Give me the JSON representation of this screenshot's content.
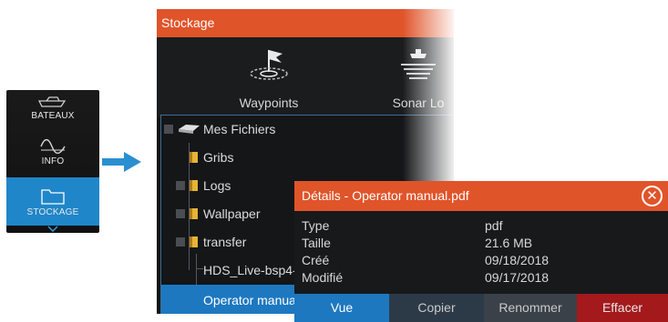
{
  "sidebar": {
    "items": [
      {
        "label": "BATEAUX",
        "icon": "boat-icon"
      },
      {
        "label": "INFO",
        "icon": "waveform-icon"
      },
      {
        "label": "STOCKAGE",
        "icon": "folder-icon",
        "selected": true
      }
    ]
  },
  "storage": {
    "title": "Stockage",
    "tiles": [
      {
        "label": "Waypoints",
        "icon": "waypoint-flag-icon"
      },
      {
        "label": "Sonar Lo",
        "icon": "sonar-log-icon"
      }
    ],
    "tree": [
      {
        "label": "Mes Fichiers",
        "icon": "drive-icon"
      },
      {
        "label": "Gribs",
        "icon": "folder-icon"
      },
      {
        "label": "Logs",
        "icon": "folder-icon"
      },
      {
        "label": "Wallpaper",
        "icon": "folder-icon"
      },
      {
        "label": "transfer",
        "icon": "folder-icon"
      },
      {
        "label": "HDS_Live-bsp4-"
      },
      {
        "label": "Operator manua",
        "selected": true
      }
    ]
  },
  "details": {
    "title": "Détails - Operator manual.pdf",
    "fields": [
      {
        "key": "Type",
        "value": "pdf"
      },
      {
        "key": "Taille",
        "value": "21.6 MB"
      },
      {
        "key": "Créé",
        "value": "09/18/2018"
      },
      {
        "key": "Modifié",
        "value": "09/17/2018"
      }
    ],
    "buttons": {
      "view": "Vue",
      "copy": "Copier",
      "rename": "Renommer",
      "delete": "Effacer"
    }
  },
  "colors": {
    "title_bar": "#e0542a",
    "selection": "#1d78c0",
    "delete": "#a3191c",
    "panel_bg": "#141618"
  }
}
